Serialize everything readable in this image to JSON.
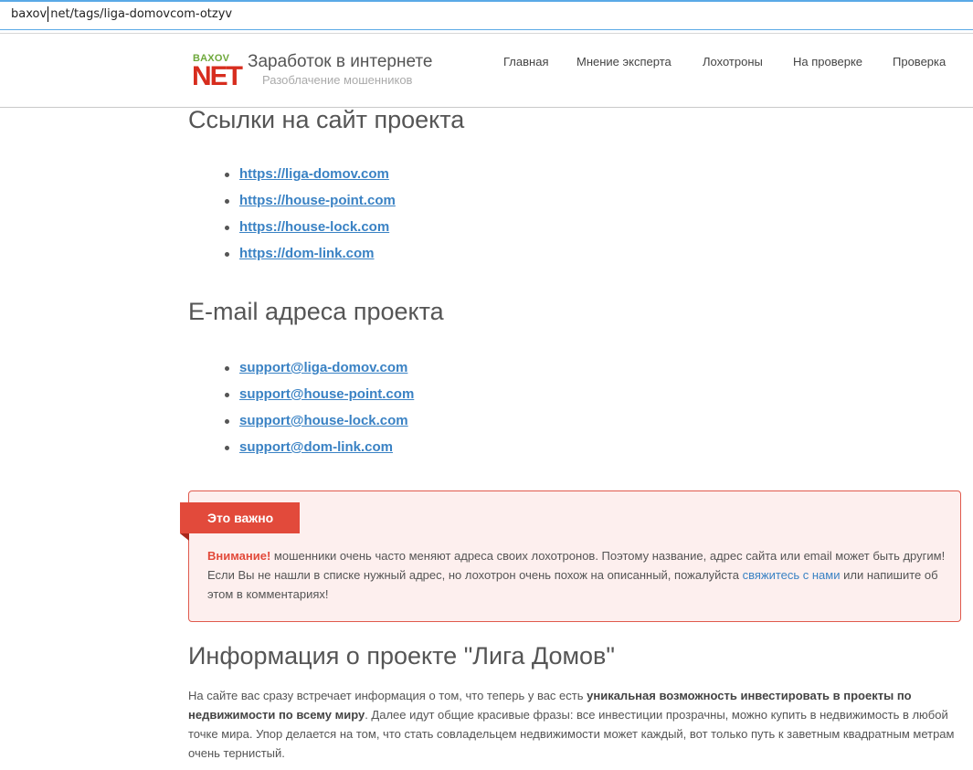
{
  "browser": {
    "url": "baxov net/tags/liga-domovcom-otzyv"
  },
  "header": {
    "logo_top": "BAXOV",
    "logo_bottom": "NET",
    "title": "Заработок в интернете",
    "subtitle": "Разоблачение мошенников",
    "nav": [
      "Главная",
      "Мнение эксперта",
      "Лохотроны",
      "На проверке",
      "Проверка"
    ]
  },
  "links_section": {
    "heading": "Ссылки на сайт проекта",
    "items": [
      "https://liga-domov.com",
      "https://house-point.com",
      "https://house-lock.com",
      "https://dom-link.com"
    ]
  },
  "email_section": {
    "heading": "E-mail адреса проекта",
    "items": [
      "support@liga-domov.com",
      "support@house-point.com",
      "support@house-lock.com",
      "support@dom-link.com"
    ]
  },
  "alert": {
    "ribbon": "Это важно",
    "warn": "Внимание!",
    "text1": " мошенники очень часто меняют адреса своих лохотронов. Поэтому название, адрес сайта или email может быть другим! Если Вы не нашли в списке нужный адрес, но лохотрон очень похож на описанный, пожалуйста ",
    "contact_link": "свяжитесь с нами",
    "text2": " или напишите об этом в комментариях!"
  },
  "info_section": {
    "heading": "Информация о проекте \"Лига Домов\"",
    "p1": "На сайте вас сразу встречает информация о том, что теперь у вас есть ",
    "p_bold": "уникальная возможность инвестировать в проекты по недвижимости по всему миру",
    "p2": ". Далее идут общие красивые фразы: все инвестиции прозрачны, можно купить в недвижимость в любой точке мира. Упор делается на том, что стать совладельцем недвижимости может каждый, вот только путь к заветным квадратным метрам очень тернистый."
  },
  "colors": {
    "link": "#3a82c4",
    "accent": "#e24a3b",
    "alert_bg": "#fdefee"
  }
}
